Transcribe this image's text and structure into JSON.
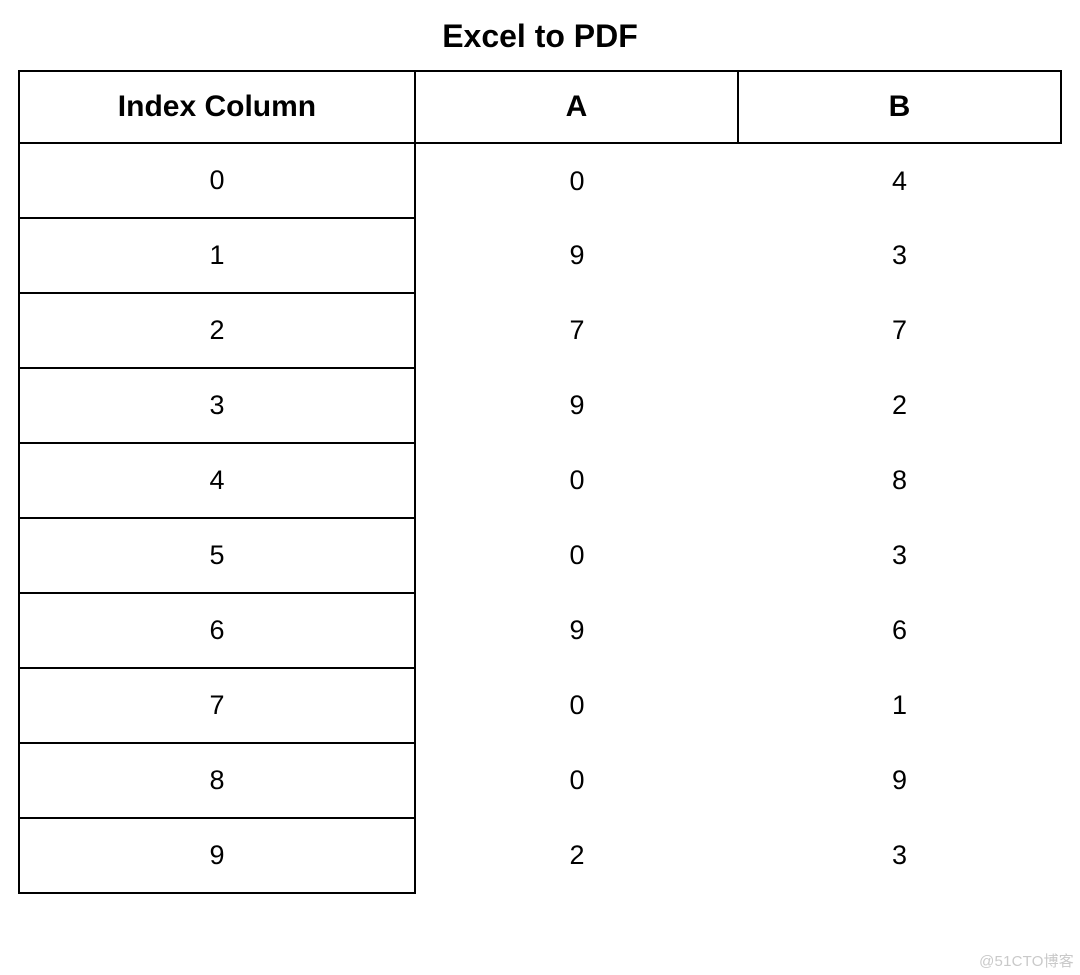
{
  "title": "Excel to PDF",
  "headers": {
    "index": "Index Column",
    "a": "A",
    "b": "B"
  },
  "rows": [
    {
      "index": "0",
      "a": "0",
      "b": "4"
    },
    {
      "index": "1",
      "a": "9",
      "b": "3"
    },
    {
      "index": "2",
      "a": "7",
      "b": "7"
    },
    {
      "index": "3",
      "a": "9",
      "b": "2"
    },
    {
      "index": "4",
      "a": "0",
      "b": "8"
    },
    {
      "index": "5",
      "a": "0",
      "b": "3"
    },
    {
      "index": "6",
      "a": "9",
      "b": "6"
    },
    {
      "index": "7",
      "a": "0",
      "b": "1"
    },
    {
      "index": "8",
      "a": "0",
      "b": "9"
    },
    {
      "index": "9",
      "a": "2",
      "b": "3"
    }
  ],
  "watermark": "@51CTO博客",
  "chart_data": {
    "type": "table",
    "title": "Excel to PDF",
    "columns": [
      "Index Column",
      "A",
      "B"
    ],
    "data": [
      [
        0,
        0,
        4
      ],
      [
        1,
        9,
        3
      ],
      [
        2,
        7,
        7
      ],
      [
        3,
        9,
        2
      ],
      [
        4,
        0,
        8
      ],
      [
        5,
        0,
        3
      ],
      [
        6,
        9,
        6
      ],
      [
        7,
        0,
        1
      ],
      [
        8,
        0,
        9
      ],
      [
        9,
        2,
        3
      ]
    ]
  }
}
